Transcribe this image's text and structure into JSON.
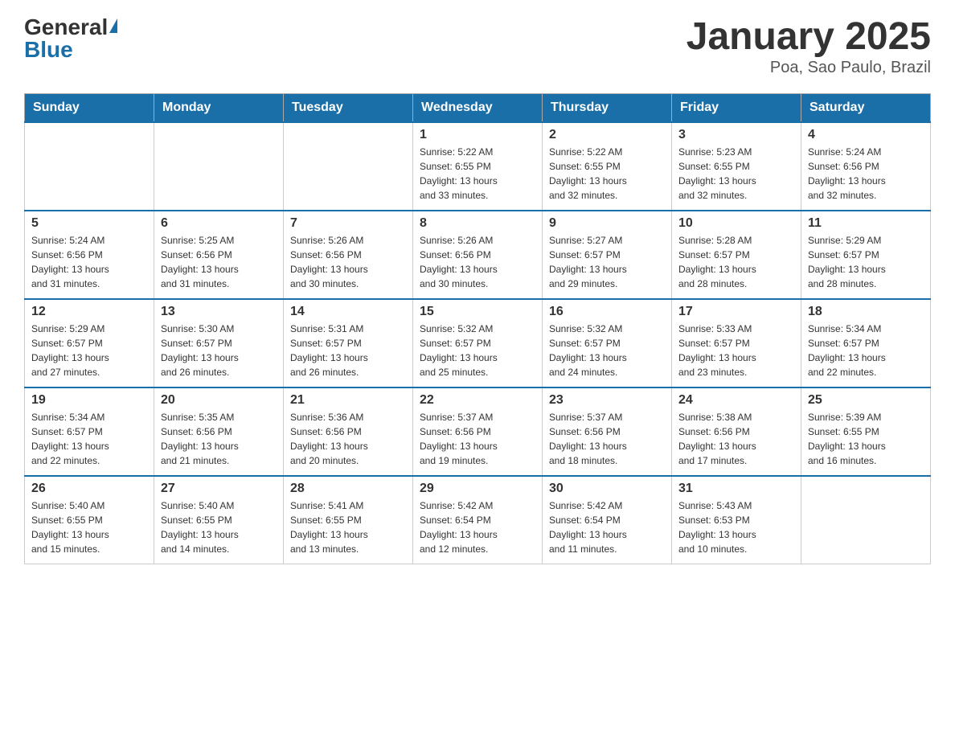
{
  "logo": {
    "general": "General",
    "blue": "Blue"
  },
  "title": "January 2025",
  "subtitle": "Poa, Sao Paulo, Brazil",
  "days_of_week": [
    "Sunday",
    "Monday",
    "Tuesday",
    "Wednesday",
    "Thursday",
    "Friday",
    "Saturday"
  ],
  "weeks": [
    [
      {
        "day": "",
        "info": ""
      },
      {
        "day": "",
        "info": ""
      },
      {
        "day": "",
        "info": ""
      },
      {
        "day": "1",
        "info": "Sunrise: 5:22 AM\nSunset: 6:55 PM\nDaylight: 13 hours\nand 33 minutes."
      },
      {
        "day": "2",
        "info": "Sunrise: 5:22 AM\nSunset: 6:55 PM\nDaylight: 13 hours\nand 32 minutes."
      },
      {
        "day": "3",
        "info": "Sunrise: 5:23 AM\nSunset: 6:55 PM\nDaylight: 13 hours\nand 32 minutes."
      },
      {
        "day": "4",
        "info": "Sunrise: 5:24 AM\nSunset: 6:56 PM\nDaylight: 13 hours\nand 32 minutes."
      }
    ],
    [
      {
        "day": "5",
        "info": "Sunrise: 5:24 AM\nSunset: 6:56 PM\nDaylight: 13 hours\nand 31 minutes."
      },
      {
        "day": "6",
        "info": "Sunrise: 5:25 AM\nSunset: 6:56 PM\nDaylight: 13 hours\nand 31 minutes."
      },
      {
        "day": "7",
        "info": "Sunrise: 5:26 AM\nSunset: 6:56 PM\nDaylight: 13 hours\nand 30 minutes."
      },
      {
        "day": "8",
        "info": "Sunrise: 5:26 AM\nSunset: 6:56 PM\nDaylight: 13 hours\nand 30 minutes."
      },
      {
        "day": "9",
        "info": "Sunrise: 5:27 AM\nSunset: 6:57 PM\nDaylight: 13 hours\nand 29 minutes."
      },
      {
        "day": "10",
        "info": "Sunrise: 5:28 AM\nSunset: 6:57 PM\nDaylight: 13 hours\nand 28 minutes."
      },
      {
        "day": "11",
        "info": "Sunrise: 5:29 AM\nSunset: 6:57 PM\nDaylight: 13 hours\nand 28 minutes."
      }
    ],
    [
      {
        "day": "12",
        "info": "Sunrise: 5:29 AM\nSunset: 6:57 PM\nDaylight: 13 hours\nand 27 minutes."
      },
      {
        "day": "13",
        "info": "Sunrise: 5:30 AM\nSunset: 6:57 PM\nDaylight: 13 hours\nand 26 minutes."
      },
      {
        "day": "14",
        "info": "Sunrise: 5:31 AM\nSunset: 6:57 PM\nDaylight: 13 hours\nand 26 minutes."
      },
      {
        "day": "15",
        "info": "Sunrise: 5:32 AM\nSunset: 6:57 PM\nDaylight: 13 hours\nand 25 minutes."
      },
      {
        "day": "16",
        "info": "Sunrise: 5:32 AM\nSunset: 6:57 PM\nDaylight: 13 hours\nand 24 minutes."
      },
      {
        "day": "17",
        "info": "Sunrise: 5:33 AM\nSunset: 6:57 PM\nDaylight: 13 hours\nand 23 minutes."
      },
      {
        "day": "18",
        "info": "Sunrise: 5:34 AM\nSunset: 6:57 PM\nDaylight: 13 hours\nand 22 minutes."
      }
    ],
    [
      {
        "day": "19",
        "info": "Sunrise: 5:34 AM\nSunset: 6:57 PM\nDaylight: 13 hours\nand 22 minutes."
      },
      {
        "day": "20",
        "info": "Sunrise: 5:35 AM\nSunset: 6:56 PM\nDaylight: 13 hours\nand 21 minutes."
      },
      {
        "day": "21",
        "info": "Sunrise: 5:36 AM\nSunset: 6:56 PM\nDaylight: 13 hours\nand 20 minutes."
      },
      {
        "day": "22",
        "info": "Sunrise: 5:37 AM\nSunset: 6:56 PM\nDaylight: 13 hours\nand 19 minutes."
      },
      {
        "day": "23",
        "info": "Sunrise: 5:37 AM\nSunset: 6:56 PM\nDaylight: 13 hours\nand 18 minutes."
      },
      {
        "day": "24",
        "info": "Sunrise: 5:38 AM\nSunset: 6:56 PM\nDaylight: 13 hours\nand 17 minutes."
      },
      {
        "day": "25",
        "info": "Sunrise: 5:39 AM\nSunset: 6:55 PM\nDaylight: 13 hours\nand 16 minutes."
      }
    ],
    [
      {
        "day": "26",
        "info": "Sunrise: 5:40 AM\nSunset: 6:55 PM\nDaylight: 13 hours\nand 15 minutes."
      },
      {
        "day": "27",
        "info": "Sunrise: 5:40 AM\nSunset: 6:55 PM\nDaylight: 13 hours\nand 14 minutes."
      },
      {
        "day": "28",
        "info": "Sunrise: 5:41 AM\nSunset: 6:55 PM\nDaylight: 13 hours\nand 13 minutes."
      },
      {
        "day": "29",
        "info": "Sunrise: 5:42 AM\nSunset: 6:54 PM\nDaylight: 13 hours\nand 12 minutes."
      },
      {
        "day": "30",
        "info": "Sunrise: 5:42 AM\nSunset: 6:54 PM\nDaylight: 13 hours\nand 11 minutes."
      },
      {
        "day": "31",
        "info": "Sunrise: 5:43 AM\nSunset: 6:53 PM\nDaylight: 13 hours\nand 10 minutes."
      },
      {
        "day": "",
        "info": ""
      }
    ]
  ]
}
